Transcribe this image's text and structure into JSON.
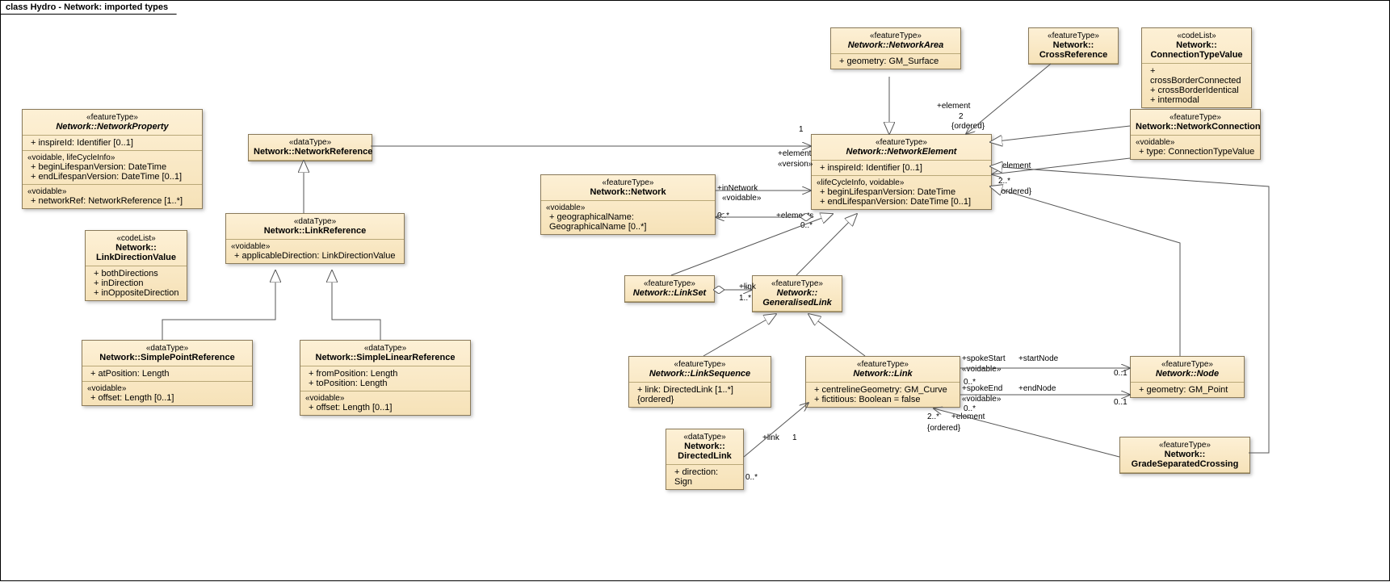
{
  "frame_title": "class Hydro - Network: imported types",
  "boxes": {
    "networkProperty": {
      "stereotype": "«featureType»",
      "name": "Network::NetworkProperty",
      "sections": [
        {
          "attrs": [
            "+   inspireId: Identifier [0..1]"
          ]
        },
        {
          "label": "«voidable, lifeCycleInfo»",
          "attrs": [
            "+   beginLifespanVersion: DateTime",
            "+   endLifespanVersion: DateTime [0..1]"
          ]
        },
        {
          "label": "«voidable»",
          "attrs": [
            "+   networkRef: NetworkReference [1..*]"
          ]
        }
      ]
    },
    "linkDirectionValue": {
      "stereotype": "«codeList»",
      "name": "Network::\nLinkDirectionValue",
      "sections": [
        {
          "attrs": [
            "+   bothDirections",
            "+   inDirection",
            "+   inOppositeDirection"
          ]
        }
      ]
    },
    "networkReference": {
      "stereotype": "«dataType»",
      "name": "Network::NetworkReference",
      "sections": []
    },
    "linkReference": {
      "stereotype": "«dataType»",
      "name": "Network::LinkReference",
      "sections": [
        {
          "label": "«voidable»",
          "attrs": [
            "+   applicableDirection: LinkDirectionValue"
          ]
        }
      ]
    },
    "simplePointReference": {
      "stereotype": "«dataType»",
      "name": "Network::SimplePointReference",
      "sections": [
        {
          "attrs": [
            "+   atPosition: Length"
          ]
        },
        {
          "label": "«voidable»",
          "attrs": [
            "+   offset: Length [0..1]"
          ]
        }
      ]
    },
    "simpleLinearReference": {
      "stereotype": "«dataType»",
      "name": "Network::SimpleLinearReference",
      "sections": [
        {
          "attrs": [
            "+   fromPosition: Length",
            "+   toPosition: Length"
          ]
        },
        {
          "label": "«voidable»",
          "attrs": [
            "+   offset: Length [0..1]"
          ]
        }
      ]
    },
    "network": {
      "stereotype": "«featureType»",
      "name": "Network::Network",
      "sections": [
        {
          "label": "«voidable»",
          "attrs": [
            "+   geographicalName: GeographicalName [0..*]"
          ]
        }
      ]
    },
    "networkArea": {
      "stereotype": "«featureType»",
      "name": "Network::NetworkArea",
      "sections": [
        {
          "attrs": [
            "+   geometry: GM_Surface"
          ]
        }
      ]
    },
    "crossReference": {
      "stereotype": "«featureType»",
      "name": "Network::\nCrossReference",
      "sections": []
    },
    "connectionTypeValue": {
      "stereotype": "«codeList»",
      "name": "Network::\nConnectionTypeValue",
      "sections": [
        {
          "attrs": [
            "+   crossBorderConnected",
            "+   crossBorderIdentical",
            "+   intermodal"
          ]
        }
      ]
    },
    "networkConnection": {
      "stereotype": "«featureType»",
      "name": "Network::NetworkConnection",
      "sections": [
        {
          "label": "«voidable»",
          "attrs": [
            "+   type: ConnectionTypeValue"
          ]
        }
      ]
    },
    "networkElement": {
      "stereotype": "«featureType»",
      "name": "Network::NetworkElement",
      "sections": [
        {
          "label": "«version»",
          "attrs": [
            "+   inspireId: Identifier [0..1]"
          ]
        },
        {
          "label": "«lifeCycleInfo, voidable»",
          "attrs": [
            "+   beginLifespanVersion: DateTime",
            "+   endLifespanVersion: DateTime [0..1]"
          ]
        }
      ]
    },
    "linkSet": {
      "stereotype": "«featureType»",
      "name": "Network::LinkSet",
      "sections": []
    },
    "generalisedLink": {
      "stereotype": "«featureType»",
      "name": "Network::\nGeneralisedLink",
      "sections": []
    },
    "linkSequence": {
      "stereotype": "«featureType»",
      "name": "Network::LinkSequence",
      "sections": [
        {
          "attrs": [
            "+   link: DirectedLink [1..*] {ordered}"
          ]
        }
      ]
    },
    "link": {
      "stereotype": "«featureType»",
      "name": "Network::Link",
      "sections": [
        {
          "attrs": [
            "+   centrelineGeometry: GM_Curve",
            "+   fictitious: Boolean = false"
          ]
        }
      ]
    },
    "directedLink": {
      "stereotype": "«dataType»",
      "name": "Network::\nDirectedLink",
      "sections": [
        {
          "attrs": [
            "+   direction: Sign"
          ]
        }
      ]
    },
    "node": {
      "stereotype": "«featureType»",
      "name": "Network::Node",
      "sections": [
        {
          "attrs": [
            "+   geometry: GM_Point"
          ]
        }
      ]
    },
    "gradeSeparatedCrossing": {
      "stereotype": "«featureType»",
      "name": "Network::\nGradeSeparatedCrossing",
      "sections": []
    }
  },
  "labels": {
    "elem": "+element",
    "elems": "+elements",
    "inNet": "+inNetwork",
    "void": "«voidable»",
    "ordered": "{ordered}",
    "link": "+link",
    "spokeStart": "+spokeStart",
    "spokeEnd": "+spokeEnd",
    "startNode": "+startNode",
    "endNode": "+endNode",
    "m_1": "1",
    "m_2": "2",
    "m_0s": "0..*",
    "m_1s": "1..*",
    "m_2s": "2..*",
    "m_01": "0..1"
  }
}
